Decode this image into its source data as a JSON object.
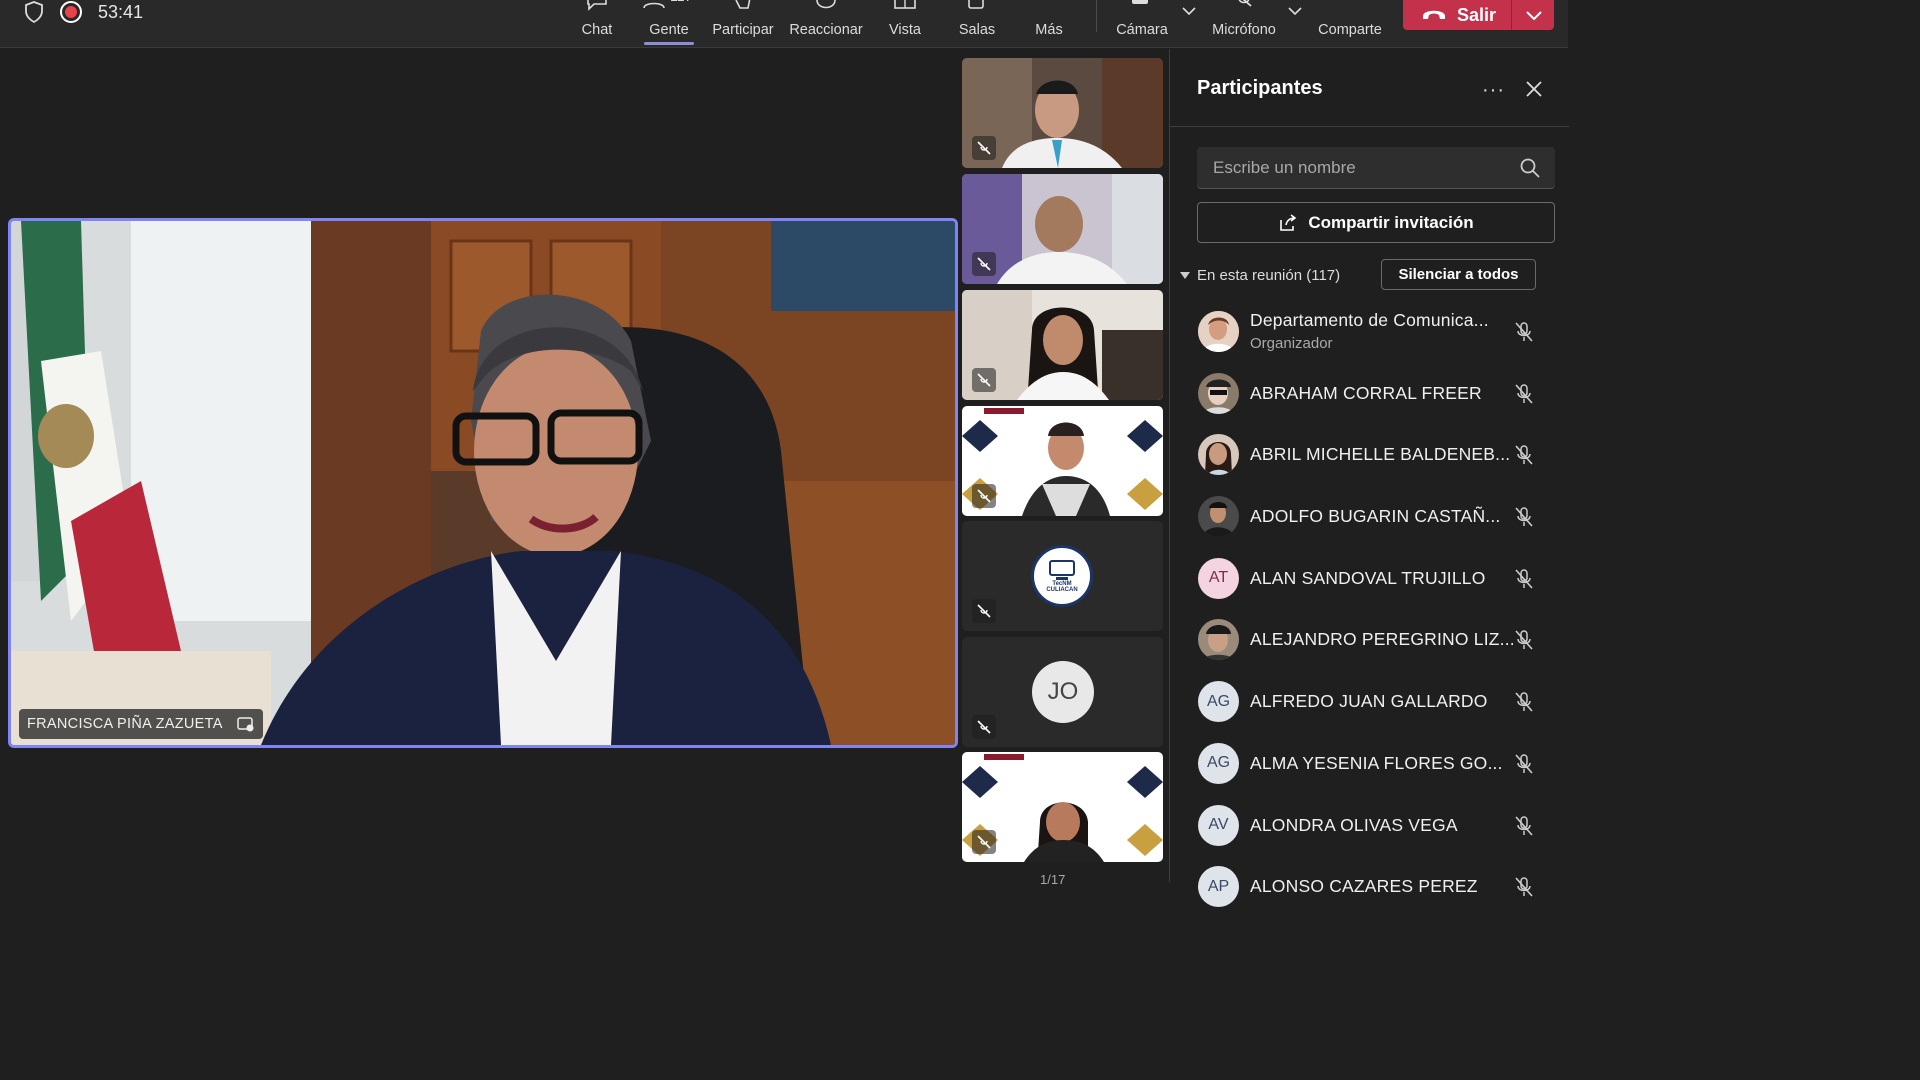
{
  "meeting": {
    "timer": "53:41",
    "toolbar": {
      "chat": "Chat",
      "people": "Gente",
      "people_count": "117",
      "raise": "Participar",
      "react": "Reaccionar",
      "view": "Vista",
      "rooms": "Salas",
      "more": "Más",
      "camera": "Cámara",
      "mic": "Micrófono",
      "share": "Comparte",
      "leave": "Salir"
    }
  },
  "stage": {
    "speaker_name": "FRANCISCA PIÑA ZAZUETA",
    "thumb_initials": "JO",
    "logo_text": "TecNM CULIACAN",
    "page_indicator": "1/17"
  },
  "panel": {
    "title": "Participantes",
    "search_placeholder": "Escribe un nombre",
    "invite": "Compartir invitación",
    "section": "En esta reunión (117)",
    "mute_all": "Silenciar a todos",
    "participants": [
      {
        "name": "Departamento de Comunica...",
        "role": "Organizador",
        "initials": "",
        "photo": true
      },
      {
        "name": "ABRAHAM CORRAL FREER",
        "role": "",
        "initials": "",
        "photo": true
      },
      {
        "name": "ABRIL MICHELLE BALDENEB...",
        "role": "",
        "initials": "",
        "photo": true
      },
      {
        "name": "ADOLFO BUGARIN CASTAÑ...",
        "role": "",
        "initials": "",
        "photo": true
      },
      {
        "name": "ALAN SANDOVAL TRUJILLO",
        "role": "",
        "initials": "AT",
        "photo": false
      },
      {
        "name": "ALEJANDRO PEREGRINO LIZ...",
        "role": "",
        "initials": "",
        "photo": true
      },
      {
        "name": "ALFREDO JUAN GALLARDO",
        "role": "",
        "initials": "AG",
        "photo": false
      },
      {
        "name": "ALMA YESENIA FLORES GO...",
        "role": "",
        "initials": "AG",
        "photo": false
      },
      {
        "name": "ALONDRA OLIVAS VEGA",
        "role": "",
        "initials": "AV",
        "photo": false
      },
      {
        "name": "ALONSO CAZARES PEREZ",
        "role": "",
        "initials": "AP",
        "photo": false
      }
    ]
  },
  "colors": {
    "accent": "#7f85f5",
    "leave": "#c4314b",
    "record": "#e8424a"
  }
}
